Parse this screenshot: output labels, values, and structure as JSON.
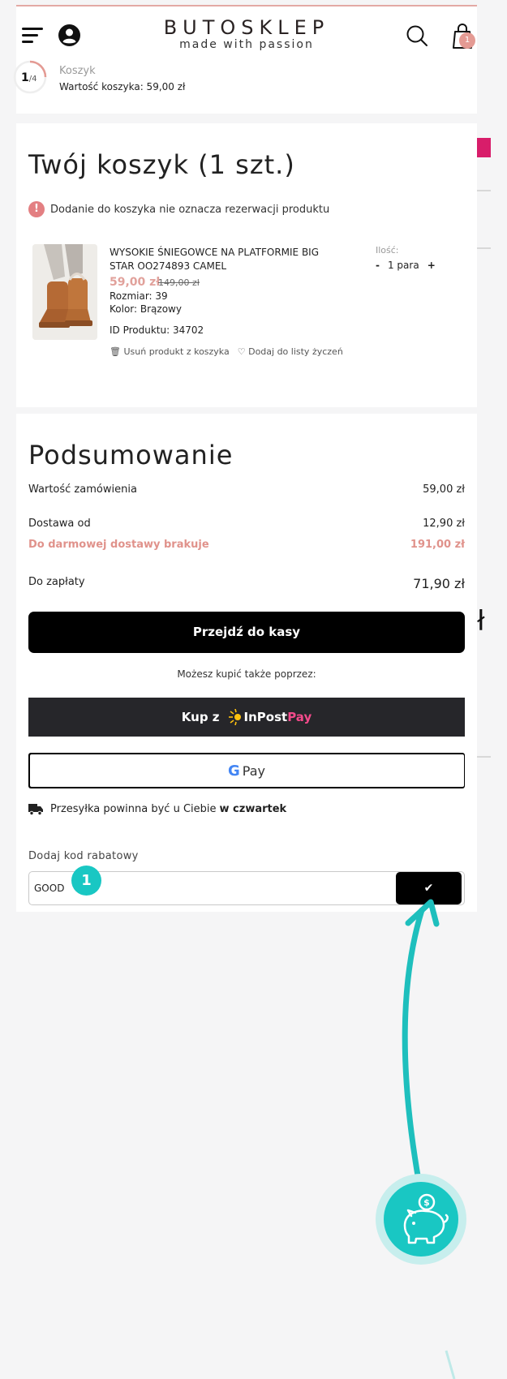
{
  "header": {
    "brand": "BUTOSKLEP",
    "tagline": "made with passion",
    "cart_count": "1"
  },
  "progress": {
    "step": "1",
    "total": "/4",
    "crumb": "Koszyk",
    "value_text": "Wartość koszyka: 59,00 zł"
  },
  "cart": {
    "title": "Twój koszyk (1 szt.)",
    "notice": "Dodanie do koszyka nie oznacza rezerwacji produktu",
    "product": {
      "name": "WYSOKIE ŚNIEGOWCE NA PLATFORMIE BIG STAR OO274893 CAMEL",
      "price": "59,00 zł",
      "old_price": "149,00 zł",
      "size": "Rozmiar: 39",
      "color": "Kolor: Brązowy",
      "id": "ID Produktu: 34702",
      "remove_label": "Usuń produkt z koszyka",
      "wishlist_label": "Dodaj do listy życzeń",
      "qty_label": "Ilość:",
      "qty_minus": "-",
      "qty_value": "1 para",
      "qty_plus": "+"
    }
  },
  "summary": {
    "title": "Podsumowanie",
    "rows": [
      {
        "label": "Wartość zamówienia",
        "value": "59,00 zł"
      },
      {
        "label": "Dostawa od",
        "value": "12,90 zł"
      },
      {
        "label": "Do darmowej dostawy brakuje",
        "value": "191,00 zł"
      },
      {
        "label": "Do zapłaty",
        "value": "71,90 zł"
      }
    ],
    "checkout_label": "Przejdź do kasy",
    "alt_text": "Możesz kupić także poprzez:",
    "inpost_prefix": "Kup z",
    "inpost_brand": "InPost",
    "inpost_pay": "Pay",
    "gpay_g": "G",
    "gpay_label": "Pay",
    "delivery_text": "Przesyłka powinna być u Ciebie",
    "delivery_day": "w czwartek",
    "coupon_label": "Dodaj kod rabatowy",
    "coupon_value": "GOOD",
    "coupon_submit": "✔"
  },
  "overlay": {
    "marker": "1",
    "side_glyph": "ł",
    "accent": "#19c7c3"
  }
}
